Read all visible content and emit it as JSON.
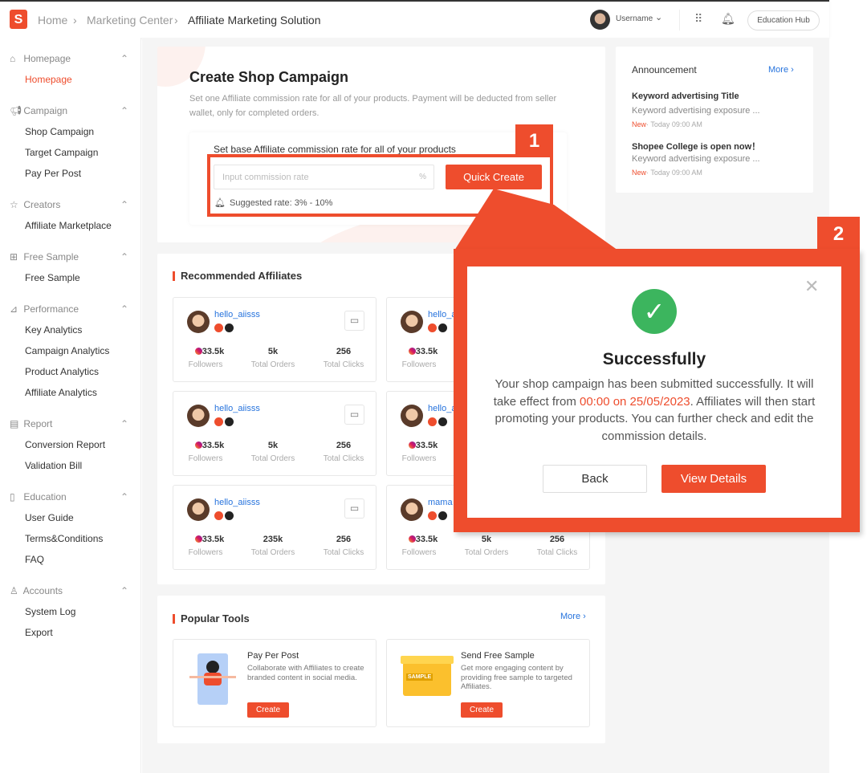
{
  "header": {
    "breadcrumb": [
      "Home",
      "Marketing Center",
      "Affiliate Marketing Solution"
    ],
    "username": "Username",
    "education_hub": "Education Hub",
    "logo": "S"
  },
  "sidebar": {
    "groups": [
      {
        "label": "Homepage",
        "icon": "home-icon",
        "items": [
          "Homepage"
        ]
      },
      {
        "label": "Campaign",
        "icon": "megaphone-icon",
        "items": [
          "Shop Campaign",
          "Target Campaign",
          "Pay Per Post"
        ]
      },
      {
        "label": "Creators",
        "icon": "star-icon",
        "items": [
          "Affiliate Marketplace"
        ]
      },
      {
        "label": "Free Sample",
        "icon": "gift-icon",
        "items": [
          "Free Sample"
        ]
      },
      {
        "label": "Performance",
        "icon": "chart-icon",
        "items": [
          "Key Analytics",
          "Campaign Analytics",
          "Product Analytics",
          "Affiliate Analytics"
        ]
      },
      {
        "label": "Report",
        "icon": "report-icon",
        "items": [
          "Conversion Report",
          "Validation Bill"
        ]
      },
      {
        "label": "Education",
        "icon": "book-icon",
        "items": [
          "User Guide",
          "Terms&Conditions",
          "FAQ"
        ]
      },
      {
        "label": "Accounts",
        "icon": "user-icon",
        "items": [
          "System Log",
          "Export"
        ]
      }
    ],
    "active": "Homepage"
  },
  "create_campaign": {
    "title": "Create Shop Campaign",
    "description": "Set one Affiliate commission rate for all of your products. Payment will be deducted from seller wallet, only for completed orders.",
    "base_label": "Set base Affiliate commission rate for all of your products",
    "input_placeholder": "Input commission rate",
    "input_suffix": "%",
    "quick_create": "Quick Create",
    "suggested": "Suggested rate: 3% - 10%"
  },
  "announcement": {
    "title": "Announcement",
    "more": "More",
    "items": [
      {
        "title": "Keyword advertising Title",
        "desc": "Keyword advertising exposure ...",
        "badge": "New",
        "time": "· Today 09:00 AM"
      },
      {
        "title": "Shopee College is open now！",
        "desc": "Keyword advertising exposure ...",
        "badge": "New",
        "time": "· Today 09:00 AM"
      }
    ]
  },
  "recommended": {
    "title": "Recommended Affiliates",
    "labels": {
      "followers": "Followers",
      "orders": "Total Orders",
      "clicks": "Total Clicks"
    },
    "affiliates": [
      {
        "name": "hello_aiisss",
        "followers": "33.5k",
        "orders": "5k",
        "clicks": "256"
      },
      {
        "name": "hello_a",
        "followers": "33.5k",
        "orders": "",
        "clicks": ""
      },
      {
        "name": "hello_aiisss",
        "followers": "33.5k",
        "orders": "5k",
        "clicks": "256"
      },
      {
        "name": "hello_a",
        "followers": "33.5k",
        "orders": "",
        "clicks": ""
      },
      {
        "name": "hello_aiisss",
        "followers": "33.5k",
        "orders": "235k",
        "clicks": "256"
      },
      {
        "name": "mama",
        "followers": "33.5k",
        "orders": "5k",
        "clicks": "256"
      }
    ]
  },
  "popular_tools": {
    "title": "Popular Tools",
    "more": "More",
    "tools": [
      {
        "title": "Pay Per Post",
        "desc": "Collaborate with Affiliates to create branded content in social media.",
        "button": "Create"
      },
      {
        "title": "Send Free Sample",
        "desc": "Get more engaging content by providing free sample to targeted Affiliates.",
        "button": "Create",
        "image_text": "SAMPLE"
      }
    ]
  },
  "callouts": {
    "one": "1",
    "two": "2"
  },
  "success_modal": {
    "title": "Successfully",
    "text_before": "Your shop campaign has been submitted successfully. It will take effect from ",
    "highlight": "00:00 on 25/05/2023",
    "text_after": ". Affiliates will then start promoting your products. You can further check and edit the commission details.",
    "back": "Back",
    "view_details": "View Details"
  },
  "colors": {
    "brand": "#ee4d2d",
    "link": "#2673dd",
    "success": "#3cb55e"
  }
}
